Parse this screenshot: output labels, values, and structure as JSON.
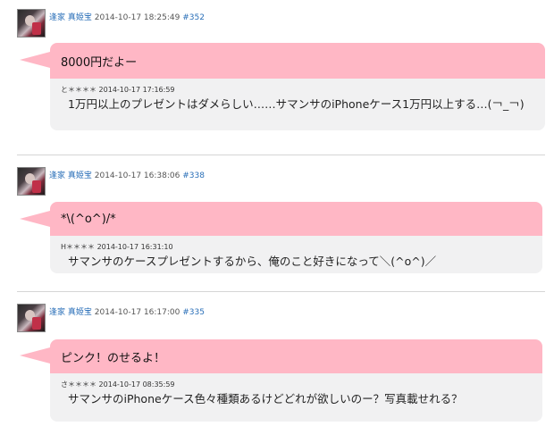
{
  "posts": [
    {
      "author": "逢家 真姫宝",
      "timestamp": "2014-10-17 18:25:49",
      "number": "#352",
      "message": "8000円だよー",
      "quote": {
        "author": "と＊＊＊＊",
        "timestamp": "2014-10-17 17:16:59",
        "text": "1万円以上のプレゼントはダメらしい……サマンサのiPhoneケース1万円以上する…(￢_￢)"
      }
    },
    {
      "author": "逢家 真姫宝",
      "timestamp": "2014-10-17 16:38:06",
      "number": "#338",
      "message": "*\\(^o^)/*",
      "quote": {
        "author": "H＊＊＊＊",
        "timestamp": "2014-10-17 16:31:10",
        "text": "サマンサのケースプレゼントするから、俺のこと好きになって＼(^o^)／"
      }
    },
    {
      "author": "逢家 真姫宝",
      "timestamp": "2014-10-17 16:17:00",
      "number": "#335",
      "message": "ピンク！のせるよ！",
      "quote": {
        "author": "さ＊＊＊＊",
        "timestamp": "2014-10-17 08:35:59",
        "text": "サマンサのiPhoneケース色々種類あるけどどれが欲しいのー？写真載せれる？"
      }
    }
  ],
  "colors": {
    "bubble": "#ffb7c5",
    "quote_bg": "#f1f1f2",
    "link": "#2a6fb8"
  }
}
